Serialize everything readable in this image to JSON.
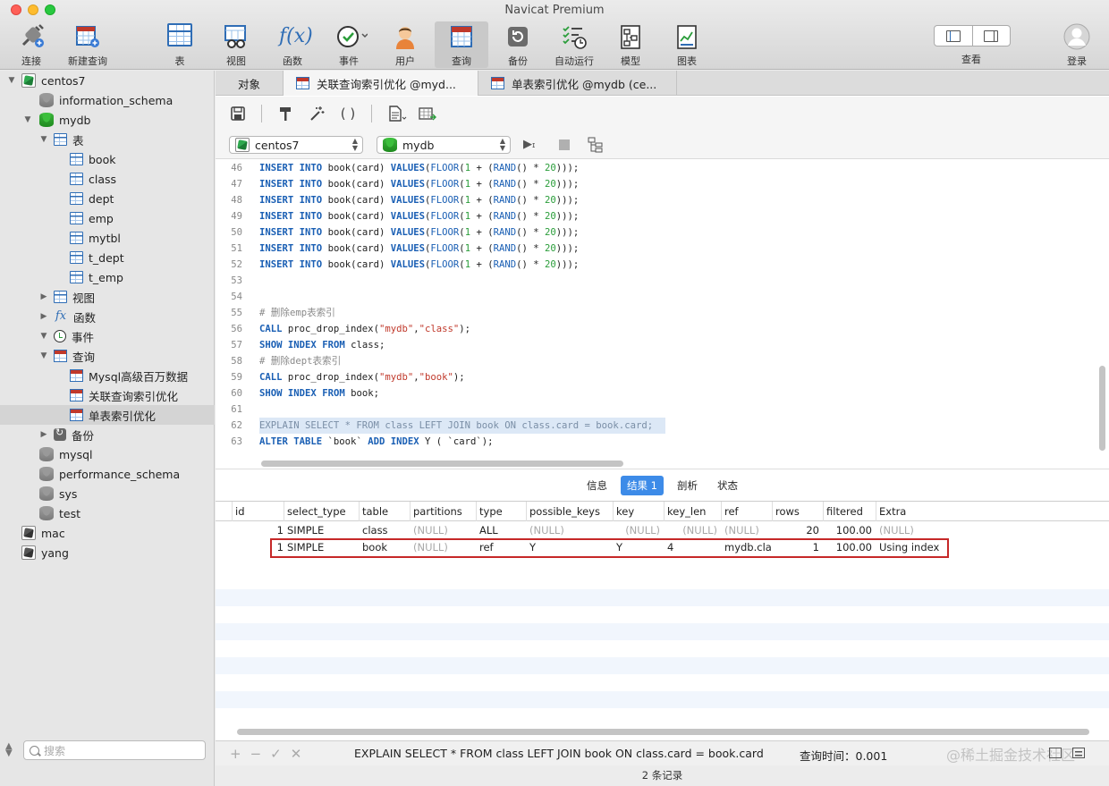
{
  "app": {
    "title": "Navicat Premium"
  },
  "toolbar": {
    "connect": "连接",
    "new_query": "新建查询",
    "table": "表",
    "view": "视图",
    "function": "函数",
    "event": "事件",
    "user": "用户",
    "query": "查询",
    "backup": "备份",
    "automation": "自动运行",
    "model": "模型",
    "chart": "图表",
    "view_mode": "查看",
    "login": "登录"
  },
  "sidebar": {
    "search_placeholder": "搜索",
    "items": [
      {
        "label": "centos7"
      },
      {
        "label": "information_schema"
      },
      {
        "label": "mydb"
      },
      {
        "label": "表"
      },
      {
        "label": "book"
      },
      {
        "label": "class"
      },
      {
        "label": "dept"
      },
      {
        "label": "emp"
      },
      {
        "label": "mytbl"
      },
      {
        "label": "t_dept"
      },
      {
        "label": "t_emp"
      },
      {
        "label": "视图"
      },
      {
        "label": "函数"
      },
      {
        "label": "事件"
      },
      {
        "label": "查询"
      },
      {
        "label": "Mysql高级百万数据"
      },
      {
        "label": "关联查询索引优化"
      },
      {
        "label": "单表索引优化"
      },
      {
        "label": "备份"
      },
      {
        "label": "mysql"
      },
      {
        "label": "performance_schema"
      },
      {
        "label": "sys"
      },
      {
        "label": "test"
      },
      {
        "label": "mac"
      },
      {
        "label": "yang"
      }
    ]
  },
  "tabs": [
    {
      "label": "对象"
    },
    {
      "label": "关联查询索引优化 @myd..."
    },
    {
      "label": "单表索引优化 @mydb (ce..."
    }
  ],
  "selectors": {
    "connection": "centos7",
    "database": "mydb"
  },
  "editor": {
    "lines": [
      "46",
      "47",
      "48",
      "49",
      "50",
      "51",
      "52",
      "53",
      "54",
      "55",
      "56",
      "57",
      "58",
      "59",
      "60",
      "61",
      "62",
      "63"
    ],
    "code": {
      "insert": "INSERT",
      "into": "INTO",
      "book_card": " book(card) ",
      "values": "VALUES",
      "floor": "FLOOR",
      "one": "1",
      "plus": " + (",
      "rand": "RAND",
      "times": "() * ",
      "twenty": "20",
      "close": ")));",
      "cm1": "# 删除emp表索引",
      "call": "CALL",
      "proc": " proc_drop_index(",
      "mydb": "\"mydb\"",
      "comma": ",",
      "class_s": "\"class\"",
      "book_s": "\"book\"",
      "end": ");",
      "show": "SHOW",
      "index": "INDEX",
      "from": "FROM",
      "class_semi": " class;",
      "book_semi": " book;",
      "cm2": "# 删除dept表索引",
      "explain_line": "EXPLAIN SELECT * FROM class LEFT JOIN book ON class.card = book.card;",
      "alter": "ALTER",
      "table": "TABLE",
      "book_q": " `book` ",
      "add": "ADD",
      "y_card": " Y ( `card`);"
    }
  },
  "result_tabs": [
    {
      "label": "信息"
    },
    {
      "label": "结果 1"
    },
    {
      "label": "剖析"
    },
    {
      "label": "状态"
    }
  ],
  "grid": {
    "columns": [
      "id",
      "select_type",
      "table",
      "partitions",
      "type",
      "possible_keys",
      "key",
      "key_len",
      "ref",
      "rows",
      "filtered",
      "Extra"
    ],
    "rows": [
      [
        "1",
        "SIMPLE",
        "class",
        "(NULL)",
        "ALL",
        "(NULL)",
        "(NULL)",
        "(NULL)",
        "(NULL)",
        "20",
        "100.00",
        "(NULL)"
      ],
      [
        "1",
        "SIMPLE",
        "book",
        "(NULL)",
        "ref",
        "Y",
        "Y",
        "4",
        "mydb.clas",
        "1",
        "100.00",
        "Using index"
      ]
    ]
  },
  "bottom": {
    "sql": "EXPLAIN SELECT * FROM class LEFT JOIN book ON class.card = book.card",
    "time": "查询时间：0.001",
    "watermark": "@稀土掘金技术社区",
    "records": "2 条记录"
  },
  "colors": {
    "accent": "#3d8be8",
    "highlight_box": "#c62828",
    "keyword": "#1a5fb4",
    "number": "#2a9d3a",
    "string": "#c0392b"
  }
}
